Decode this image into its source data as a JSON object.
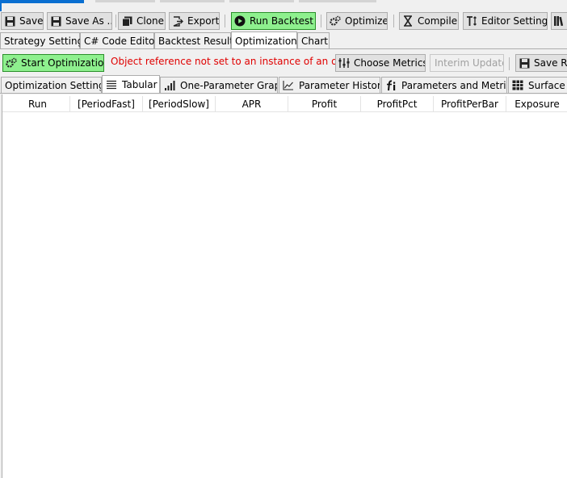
{
  "toolbar": {
    "save": "Save",
    "save_as": "Save As ...",
    "clone": "Clone",
    "export": "Export",
    "run_backtest": "Run Backtest",
    "optimize": "Optimize",
    "compile": "Compile",
    "editor_settings": "Editor Settings"
  },
  "main_tabs": [
    "Strategy Settings",
    "C# Code Editor",
    "Backtest Results",
    "Optimization",
    "Chart"
  ],
  "optimization_bar": {
    "start": "Start Optimization",
    "error": "Object reference not set to an instance of an object.",
    "choose_metrics": "Choose Metrics",
    "interim_update": "Interim Update",
    "save_results": "Save Res"
  },
  "sub_tabs": [
    "Optimization Settings",
    "Tabular",
    "One-Parameter Graph",
    "Parameter History",
    "Parameters and Metrics",
    "Surface G"
  ],
  "grid": {
    "columns": [
      "Run",
      "[PeriodFast]",
      "[PeriodSlow]",
      "APR",
      "Profit",
      "ProfitPct",
      "ProfitPerBar",
      "Exposure"
    ]
  },
  "colors": {
    "green_button": "#8ef08e",
    "error_text": "#e00000",
    "accent_blue": "#0a6fd1"
  },
  "icons": {
    "save": "floppy-disk-icon",
    "save_as": "floppy-disk-icon",
    "clone": "clone-icon",
    "export": "export-icon",
    "run_backtest": "play-icon",
    "optimize": "gears-icon",
    "compile": "hourglass-icon",
    "editor_settings": "text-height-icon",
    "library": "books-icon",
    "start_optimization": "gears-icon",
    "choose_metrics": "sliders-icon",
    "tabular": "table-lines-icon",
    "one_parameter_graph": "bar-graph-icon",
    "parameter_history": "line-chart-icon",
    "parameters_and_metrics": "function-icon",
    "surface_graph": "grid-icon"
  }
}
